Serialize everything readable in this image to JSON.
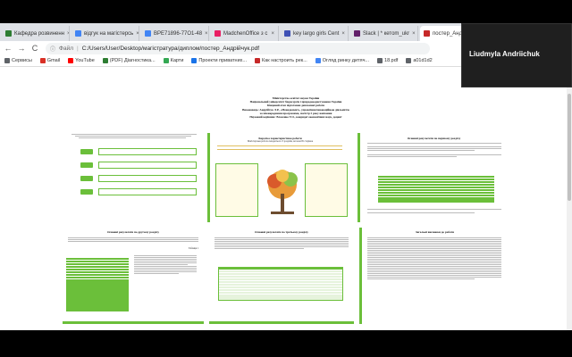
{
  "browser": {
    "tabs": [
      {
        "title": "Кафедра розвиненн",
        "icon_color": "#2e7d32"
      },
      {
        "title": "відгук на магістерсь",
        "icon_color": "#4285f4"
      },
      {
        "title": "ВРЕ71896-77О1-48",
        "icon_color": "#4285f4"
      },
      {
        "title": "MadchenOffice з с",
        "icon_color": "#e91e63"
      },
      {
        "title": "key largo girls Cent",
        "icon_color": "#3f51b5"
      },
      {
        "title": "Slack | * кетоm_ukr",
        "icon_color": "#611f69"
      },
      {
        "title": "постер_Андрій",
        "icon_color": "#c62828"
      }
    ],
    "new_tab": "+",
    "nav": {
      "back": "←",
      "forward": "→",
      "reload": "C"
    },
    "address": {
      "scheme": "Файл",
      "path": "C:/Users/User/Desktop/магістратура/диплом/постер_Андрійчук.pdf"
    },
    "bookmarks": [
      {
        "label": "Сервисы",
        "color": "#5f6368"
      },
      {
        "label": "Gmail",
        "color": "#d93025"
      },
      {
        "label": "YouTube",
        "color": "#ff0000"
      },
      {
        "label": "(PDF) Діагностика...",
        "color": "#2e7d32"
      },
      {
        "label": "Карти",
        "color": "#34a853"
      },
      {
        "label": "Проекти приватних...",
        "color": "#1a73e8"
      },
      {
        "label": "Как настроить рек...",
        "color": "#c62828"
      },
      {
        "label": "Огляд ринку дитяч...",
        "color": "#4285f4"
      },
      {
        "label": "18.pdf",
        "color": "#5f6368"
      },
      {
        "label": "a01d1d2",
        "color": "#5f6368"
      }
    ]
  },
  "video": {
    "participant": "Liudmyla Andriichuk"
  },
  "poster": {
    "header_lines": [
      "Міністерство освіти і науки України",
      "Національний університет біоресурсів і природокористування України",
      "Кінцевий етап підготовки дипломної роботи",
      "Виконавець: Андрійчук Л.Р., «Менеджмент», управління інноваційною діяльністю",
      "за міжнародними програмами, магістр 2 року навчання",
      "Науковий керівник: Власенко Т.О., кандидат економічних наук, доцент"
    ],
    "panels": {
      "p2_title": "Коротка характеристика роботи",
      "p2_subtitle": "Магістерська робота складається з 3 розділів, загалом 95 сторінок",
      "p3_title": "Основні результати по першому розділу",
      "p4_title": "Основні результати по другому розділу",
      "p5_title": "Основні результати по третьому розділу",
      "p6_title": "Загальні висновки до роботи",
      "table_caption": "Таблиця 1"
    }
  }
}
